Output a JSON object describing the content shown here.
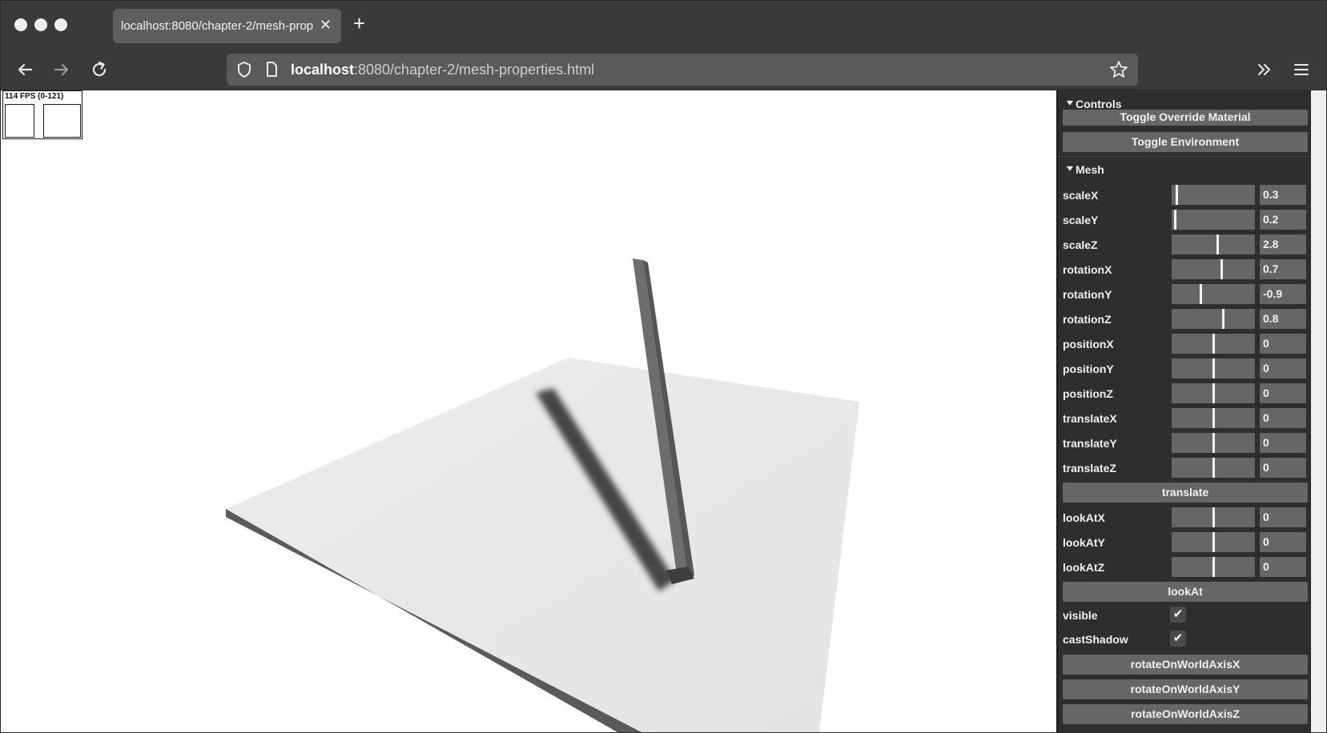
{
  "browser": {
    "tab_title": "localhost:8080/chapter-2/mesh-properties.html",
    "tab_close": "✕",
    "new_tab": "+",
    "url_host": "localhost",
    "url_rest": ":8080/chapter-2/mesh-properties.html",
    "icons": {
      "back": "back-arrow-icon",
      "forward": "forward-arrow-icon",
      "reload": "reload-icon",
      "shield": "shield-icon",
      "page": "page-icon",
      "bookmark": "star-icon",
      "overflow": "chevron-double-right-icon",
      "menu": "hamburger-menu-icon"
    }
  },
  "stats": {
    "label": "114 FPS (0-121)"
  },
  "gui": {
    "controls": {
      "title": "Controls",
      "buttons": [
        "Toggle Override Material",
        "Toggle Environment"
      ]
    },
    "mesh": {
      "title": "Mesh",
      "sliders": [
        {
          "label": "scaleX",
          "value": "0.3",
          "fraction": 0.05
        },
        {
          "label": "scaleY",
          "value": "0.2",
          "fraction": 0.03
        },
        {
          "label": "scaleZ",
          "value": "2.8",
          "fraction": 0.55
        },
        {
          "label": "rotationX",
          "value": "0.7",
          "fraction": 0.6
        },
        {
          "label": "rotationY",
          "value": "-0.9",
          "fraction": 0.35
        },
        {
          "label": "rotationZ",
          "value": "0.8",
          "fraction": 0.62
        },
        {
          "label": "positionX",
          "value": "0",
          "fraction": 0.5
        },
        {
          "label": "positionY",
          "value": "0",
          "fraction": 0.5
        },
        {
          "label": "positionZ",
          "value": "0",
          "fraction": 0.5
        },
        {
          "label": "translateX",
          "value": "0",
          "fraction": 0.5
        },
        {
          "label": "translateY",
          "value": "0",
          "fraction": 0.5
        },
        {
          "label": "translateZ",
          "value": "0",
          "fraction": 0.5
        }
      ],
      "translate_button": "translate",
      "look_sliders": [
        {
          "label": "lookAtX",
          "value": "0",
          "fraction": 0.5
        },
        {
          "label": "lookAtY",
          "value": "0",
          "fraction": 0.5
        },
        {
          "label": "lookAtZ",
          "value": "0",
          "fraction": 0.5
        }
      ],
      "lookat_button": "lookAt",
      "checkboxes": [
        {
          "label": "visible",
          "checked": true
        },
        {
          "label": "castShadow",
          "checked": true
        }
      ],
      "rotate_buttons": [
        "rotateOnWorldAxisX",
        "rotateOnWorldAxisY",
        "rotateOnWorldAxisZ"
      ]
    }
  },
  "colors": {
    "panel_bg": "#2e2e2e",
    "control_bg": "#666666",
    "chrome_bg": "#3a3a3a"
  }
}
